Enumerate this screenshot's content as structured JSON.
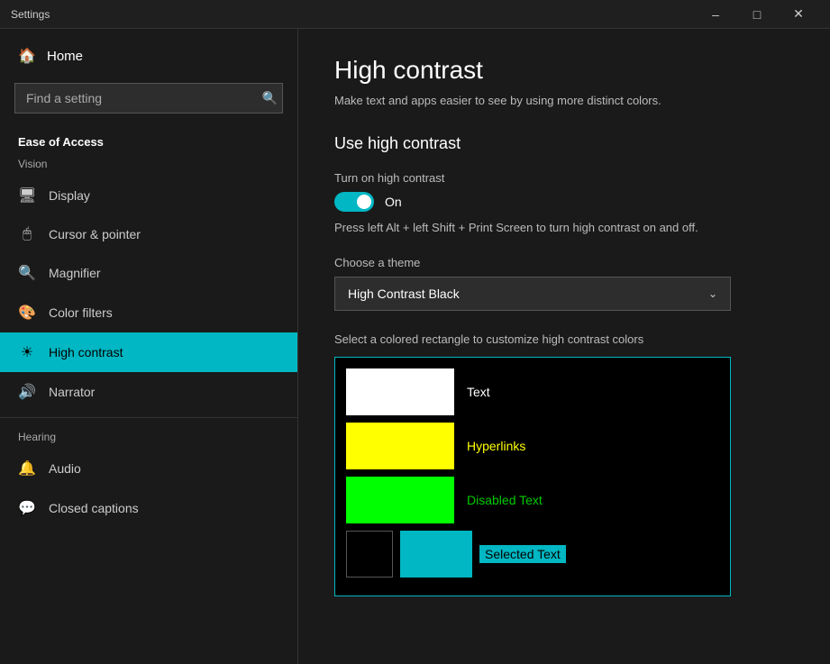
{
  "titleBar": {
    "title": "Settings",
    "minimizeLabel": "–",
    "maximizeLabel": "□",
    "closeLabel": "✕"
  },
  "sidebar": {
    "homeLabel": "Home",
    "searchPlaceholder": "Find a setting",
    "sectionLabel": "Ease of Access",
    "visionLabel": "Vision",
    "items": [
      {
        "id": "display",
        "label": "Display",
        "icon": "🖥"
      },
      {
        "id": "cursor",
        "label": "Cursor & pointer",
        "icon": "🖱"
      },
      {
        "id": "magnifier",
        "label": "Magnifier",
        "icon": "🔍"
      },
      {
        "id": "color-filters",
        "label": "Color filters",
        "icon": "🎨"
      },
      {
        "id": "high-contrast",
        "label": "High contrast",
        "icon": "☀",
        "active": true
      },
      {
        "id": "narrator",
        "label": "Narrator",
        "icon": "🔊"
      }
    ],
    "hearingLabel": "Hearing",
    "hearingItems": [
      {
        "id": "audio",
        "label": "Audio",
        "icon": "🔔"
      },
      {
        "id": "closed-captions",
        "label": "Closed captions",
        "icon": "💬"
      }
    ]
  },
  "main": {
    "pageTitle": "High contrast",
    "pageSubtitle": "Make text and apps easier to see by using more distinct colors.",
    "sectionHeading": "Use high contrast",
    "toggleLabel": "Turn on high contrast",
    "toggleState": "On",
    "shortcutHint": "Press left Alt + left Shift + Print Screen to turn high contrast on and off.",
    "themeLabel": "Choose a theme",
    "themeValue": "High Contrast Black",
    "colorRectLabel": "Select a colored rectangle to customize high contrast colors",
    "colorRows": [
      {
        "label": "Text",
        "swatchColor": "#ffffff",
        "swatchWidth": 120,
        "swatchHeight": 52,
        "labelColor": "#ffffff"
      },
      {
        "label": "Hyperlinks",
        "swatchColor": "#ffff00",
        "swatchWidth": 120,
        "swatchHeight": 52,
        "labelColor": "#ffff00"
      },
      {
        "label": "Disabled Text",
        "swatchColor": "#00ff00",
        "swatchWidth": 120,
        "swatchHeight": 52,
        "labelColor": "#00ff00"
      },
      {
        "label": "Selected Text",
        "swatchColor": "#00b7c3",
        "swatchWidth": 120,
        "swatchHeight": 52,
        "labelColor": "#00b7c3"
      }
    ]
  },
  "icons": {
    "search": "🔍",
    "home": "🏠",
    "chevronDown": "⌵"
  }
}
